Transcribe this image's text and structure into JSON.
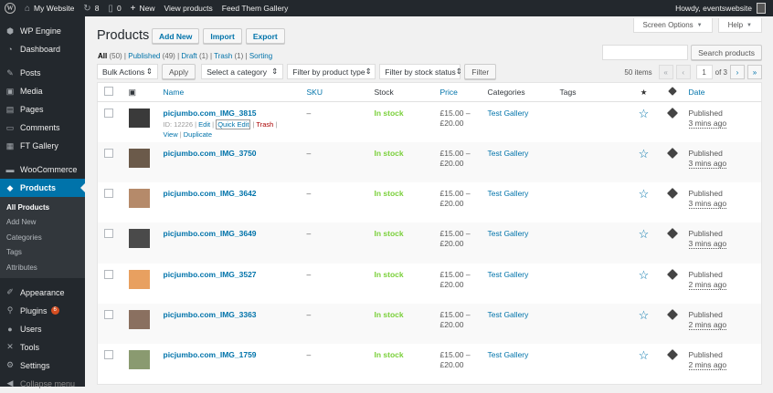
{
  "adminbar": {
    "site": "My Website",
    "updates": "8",
    "comments": "0",
    "new": "New",
    "view_products": "View products",
    "feed": "Feed Them Gallery",
    "howdy": "Howdy, eventswebsite"
  },
  "sidebar": {
    "top": [
      {
        "label": "WP Engine",
        "icon": "engine-icon"
      },
      {
        "label": "Dashboard",
        "icon": "dashboard-icon"
      }
    ],
    "mid": [
      {
        "label": "Posts",
        "icon": "pin-icon"
      },
      {
        "label": "Media",
        "icon": "media-icon"
      },
      {
        "label": "Pages",
        "icon": "pages-icon"
      },
      {
        "label": "Comments",
        "icon": "comments-icon"
      },
      {
        "label": "FT Gallery",
        "icon": "gallery-icon"
      }
    ],
    "woo": "WooCommerce",
    "products": "Products",
    "sub": [
      "All Products",
      "Add New",
      "Categories",
      "Tags",
      "Attributes"
    ],
    "bottom": [
      {
        "label": "Appearance",
        "icon": "brush-icon"
      },
      {
        "label": "Plugins",
        "icon": "plugin-icon",
        "badge": "6"
      },
      {
        "label": "Users",
        "icon": "users-icon"
      },
      {
        "label": "Tools",
        "icon": "tools-icon"
      },
      {
        "label": "Settings",
        "icon": "settings-icon"
      }
    ],
    "collapse": "Collapse menu"
  },
  "screen_options": "Screen Options",
  "help": "Help",
  "title": "Products",
  "add_new": "Add New",
  "import": "Import",
  "export": "Export",
  "views": {
    "all": "All",
    "all_count": "(50)",
    "published": "Published",
    "published_count": "(49)",
    "draft": "Draft",
    "draft_count": "(1)",
    "trash": "Trash",
    "trash_count": "(1)",
    "sorting": "Sorting"
  },
  "search_button": "Search products",
  "filters": {
    "bulk": "Bulk Actions",
    "apply": "Apply",
    "category": "Select a category",
    "type": "Filter by product type",
    "stock": "Filter by stock status",
    "filter": "Filter"
  },
  "pager": {
    "items": "50 items",
    "first": "«",
    "prev": "‹",
    "current": "1",
    "of": "of 3",
    "next": "›",
    "last": "»"
  },
  "columns": {
    "name": "Name",
    "sku": "SKU",
    "stock": "Stock",
    "price": "Price",
    "categories": "Categories",
    "tags": "Tags",
    "date": "Date"
  },
  "row_actions": {
    "id": "ID: 12226",
    "edit": "Edit",
    "quick_edit": "Quick Edit",
    "trash": "Trash",
    "view": "View",
    "duplicate": "Duplicate"
  },
  "rows": [
    {
      "name": "picjumbo.com_IMG_3815",
      "sku": "–",
      "stock": "In stock",
      "price1": "£15.00 –",
      "price2": "£20.00",
      "cat": "Test Gallery",
      "status": "Published",
      "when": "3 mins ago",
      "thumb": "#3a3a3a"
    },
    {
      "name": "picjumbo.com_IMG_3750",
      "sku": "–",
      "stock": "In stock",
      "price1": "£15.00 –",
      "price2": "£20.00",
      "cat": "Test Gallery",
      "status": "Published",
      "when": "3 mins ago",
      "thumb": "#6b5a4a"
    },
    {
      "name": "picjumbo.com_IMG_3642",
      "sku": "–",
      "stock": "In stock",
      "price1": "£15.00 –",
      "price2": "£20.00",
      "cat": "Test Gallery",
      "status": "Published",
      "when": "3 mins ago",
      "thumb": "#b58a6a"
    },
    {
      "name": "picjumbo.com_IMG_3649",
      "sku": "–",
      "stock": "In stock",
      "price1": "£15.00 –",
      "price2": "£20.00",
      "cat": "Test Gallery",
      "status": "Published",
      "when": "3 mins ago",
      "thumb": "#4a4a4a"
    },
    {
      "name": "picjumbo.com_IMG_3527",
      "sku": "–",
      "stock": "In stock",
      "price1": "£15.00 –",
      "price2": "£20.00",
      "cat": "Test Gallery",
      "status": "Published",
      "when": "2 mins ago",
      "thumb": "#e8a060"
    },
    {
      "name": "picjumbo.com_IMG_3363",
      "sku": "–",
      "stock": "In stock",
      "price1": "£15.00 –",
      "price2": "£20.00",
      "cat": "Test Gallery",
      "status": "Published",
      "when": "2 mins ago",
      "thumb": "#8a7060"
    },
    {
      "name": "picjumbo.com_IMG_1759",
      "sku": "–",
      "stock": "In stock",
      "price1": "£15.00 –",
      "price2": "£20.00",
      "cat": "Test Gallery",
      "status": "Published",
      "when": "2 mins ago",
      "thumb": "#8a9a70"
    }
  ]
}
